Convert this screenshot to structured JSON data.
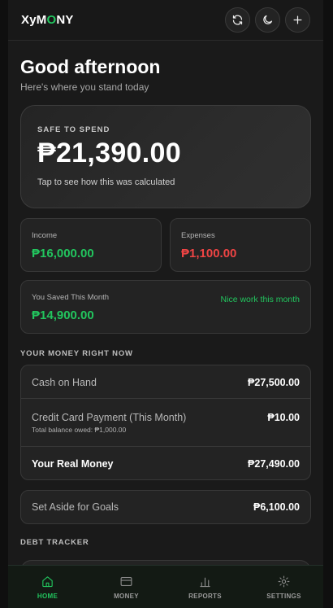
{
  "header": {
    "logo_prefix": "XyM",
    "logo_o": "O",
    "logo_suffix": "NY",
    "actions": [
      "refresh-icon",
      "moon-icon",
      "plus-icon"
    ]
  },
  "greeting": {
    "title": "Good afternoon",
    "subtitle": "Here's where you stand today"
  },
  "safe_to_spend": {
    "label": "SAFE TO SPEND",
    "value": "₱21,390.00",
    "hint": "Tap to see how this was calculated"
  },
  "income": {
    "label": "Income",
    "value": "₱16,000.00"
  },
  "expenses": {
    "label": "Expenses",
    "value": "₱1,100.00"
  },
  "saved": {
    "label": "You Saved This Month",
    "value": "₱14,900.00",
    "note": "Nice work this month"
  },
  "money_now": {
    "title": "YOUR MONEY RIGHT NOW",
    "rows": [
      {
        "label": "Cash on Hand",
        "value": "₱27,500.00"
      },
      {
        "label": "Credit Card Payment (This Month)",
        "sub": "Total balance owed: ₱1,000.00",
        "value": "₱10.00"
      },
      {
        "label": "Your Real Money",
        "value": "₱27,490.00"
      }
    ]
  },
  "goals": {
    "label": "Set Aside for Goals",
    "value": "₱6,100.00"
  },
  "debt": {
    "title": "DEBT TRACKER"
  },
  "nav": [
    {
      "label": "HOME",
      "icon": "home-icon",
      "active": true
    },
    {
      "label": "MONEY",
      "icon": "wallet-icon"
    },
    {
      "label": "REPORTS",
      "icon": "bar-chart-icon"
    },
    {
      "label": "SETTINGS",
      "icon": "gear-icon"
    }
  ],
  "colors": {
    "accent_green": "#22c55e",
    "red": "#ef4444",
    "orange": "#f59e0b"
  }
}
